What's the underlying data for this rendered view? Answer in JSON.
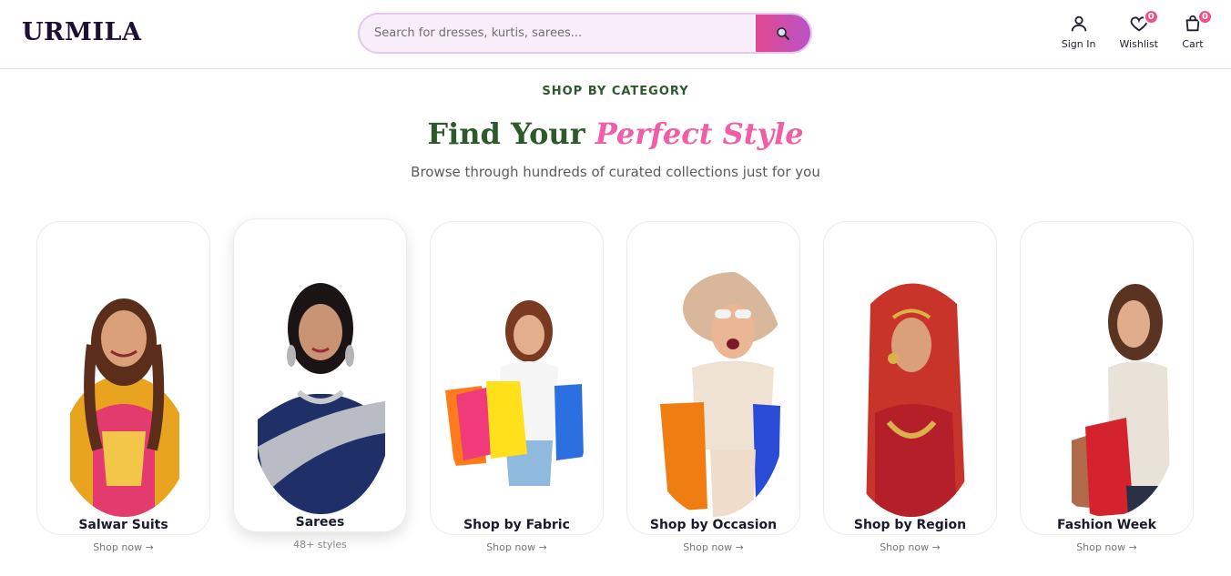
{
  "brand": {
    "name": "URMILA"
  },
  "search": {
    "placeholder": "Search for dresses, kurtis, sarees...",
    "icon": "search-icon"
  },
  "header_actions": [
    {
      "label": "Sign In",
      "icon": "user-icon"
    },
    {
      "label": "Wishlist",
      "icon": "heart-icon",
      "count": "0"
    },
    {
      "label": "Cart",
      "icon": "shopping-bag-icon",
      "count": "0"
    }
  ],
  "section": {
    "eyebrow": "SHOP BY CATEGORY",
    "title_main": "Find Your",
    "title_accent": "Perfect Style",
    "subtitle": "Browse through hundreds of curated collections just for you"
  },
  "categories": [
    {
      "name": "Salwar Suits",
      "sub": "Shop now →"
    },
    {
      "name": "Sarees",
      "sub": "48+ styles"
    },
    {
      "name": "Shop by Fabric",
      "sub": "Shop now →"
    },
    {
      "name": "Shop by Occasion",
      "sub": "Shop now →"
    },
    {
      "name": "Shop by Region",
      "sub": "Shop now →"
    },
    {
      "name": "Fashion Week",
      "sub": "Shop now →"
    }
  ],
  "colors": {
    "accent_pink": "#ef5ea6",
    "accent_green": "#2d5a2b",
    "badge": "#f0508a",
    "search_bg": "#f8eef9"
  }
}
